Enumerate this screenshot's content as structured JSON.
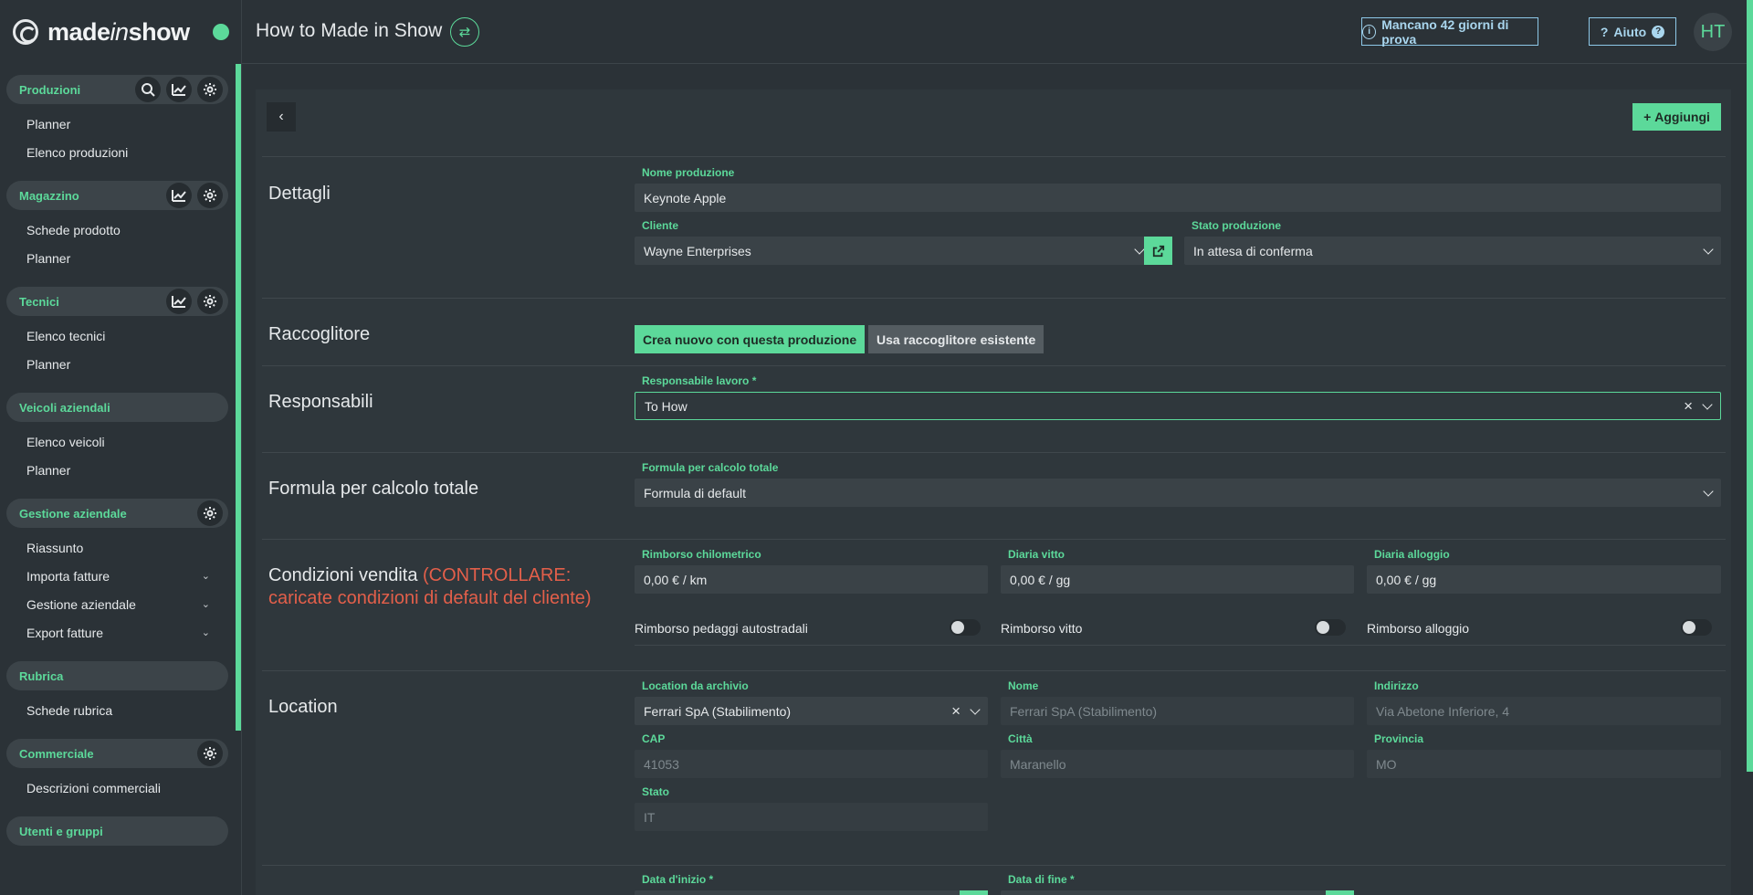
{
  "app": {
    "logo": "madeinshow",
    "title": "How to Made in Show",
    "trial": "Mancano 42 giorni di prova",
    "help": "Aiuto",
    "avatar": "HT"
  },
  "sidebar": {
    "sections": [
      {
        "title": "Produzioni",
        "icons": [
          "search-icon",
          "chart-icon",
          "gear-icon"
        ],
        "items": [
          {
            "label": "Planner"
          },
          {
            "label": "Elenco produzioni"
          }
        ]
      },
      {
        "title": "Magazzino",
        "icons": [
          "chart-icon",
          "gear-icon"
        ],
        "items": [
          {
            "label": "Schede prodotto"
          },
          {
            "label": "Planner"
          }
        ]
      },
      {
        "title": "Tecnici",
        "icons": [
          "chart-icon",
          "gear-icon"
        ],
        "items": [
          {
            "label": "Elenco tecnici"
          },
          {
            "label": "Planner"
          }
        ]
      },
      {
        "title": "Veicoli aziendali",
        "icons": [],
        "items": [
          {
            "label": "Elenco veicoli"
          },
          {
            "label": "Planner"
          }
        ]
      },
      {
        "title": "Gestione aziendale",
        "icons": [
          "gear-icon"
        ],
        "items": [
          {
            "label": "Riassunto"
          },
          {
            "label": "Importa fatture",
            "expandable": true
          },
          {
            "label": "Gestione aziendale",
            "expandable": true
          },
          {
            "label": "Export fatture",
            "expandable": true
          }
        ]
      },
      {
        "title": "Rubrica",
        "icons": [],
        "items": [
          {
            "label": "Schede rubrica"
          }
        ]
      },
      {
        "title": "Commerciale",
        "icons": [
          "gear-icon"
        ],
        "items": [
          {
            "label": "Descrizioni commerciali"
          }
        ]
      },
      {
        "title": "Utenti e gruppi",
        "icons": [],
        "items": []
      }
    ]
  },
  "toolbar": {
    "add_label": "Aggiungi"
  },
  "details": {
    "section": "Dettagli",
    "name_label": "Nome produzione",
    "name_value": "Keynote Apple",
    "client_label": "Cliente",
    "client_value": "Wayne Enterprises",
    "status_label": "Stato produzione",
    "status_value": "In attesa di conferma"
  },
  "collector": {
    "section": "Raccoglitore",
    "option_new": "Crea nuovo con questa produzione",
    "option_existing": "Usa raccoglitore esistente"
  },
  "managers": {
    "section": "Responsabili",
    "label": "Responsabile lavoro *",
    "value": "To How"
  },
  "formula": {
    "section": "Formula per calcolo totale",
    "label": "Formula per calcolo totale",
    "value": "Formula di default"
  },
  "sales": {
    "section": "Condizioni vendita",
    "warning": "(CONTROLLARE: caricate condizioni di default del cliente)",
    "km_label": "Rimborso chilometrico",
    "km_value": "0,00 € / km",
    "food_label": "Diaria vitto",
    "food_value": "0,00 € / gg",
    "lodging_label": "Diaria alloggio",
    "lodging_value": "0,00 € / gg",
    "toll_toggle": "Rimborso pedaggi autostradali",
    "food_toggle": "Rimborso vitto",
    "lodging_toggle": "Rimborso alloggio"
  },
  "location": {
    "section": "Location",
    "archive_label": "Location da archivio",
    "archive_value": "Ferrari SpA (Stabilimento)",
    "name_label": "Nome",
    "name_value": "Ferrari SpA (Stabilimento)",
    "address_label": "Indirizzo",
    "address_value": "Via Abetone Inferiore, 4",
    "cap_label": "CAP",
    "cap_value": "41053",
    "city_label": "Città",
    "city_value": "Maranello",
    "province_label": "Provincia",
    "province_value": "MO",
    "country_label": "Stato",
    "country_value": "IT"
  },
  "dates": {
    "start_label": "Data d'inizio *",
    "end_label": "Data di fine *"
  },
  "colors": {
    "accent": "#5cd99a",
    "warning": "#e35f4a",
    "info": "#a9d6ee",
    "background": "#2b3237"
  }
}
